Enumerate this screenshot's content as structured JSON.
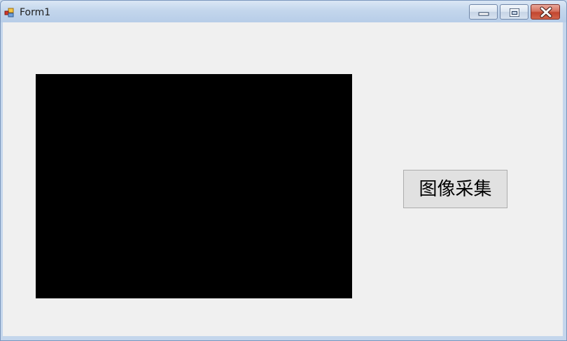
{
  "window": {
    "title": "Form1",
    "icon": "winforms-app-icon",
    "controls": {
      "minimize": "minimize-icon",
      "maximize": "maximize-icon",
      "close": "close-icon"
    }
  },
  "form": {
    "picture_box": {
      "background": "#000000"
    },
    "capture_button": {
      "label": "图像采集"
    }
  },
  "colors": {
    "client_background": "#f0f0f0",
    "titlebar": "#c3d6ec",
    "close_button": "#c2462f"
  }
}
